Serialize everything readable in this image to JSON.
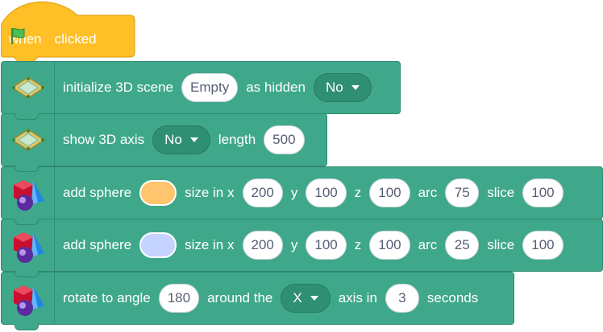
{
  "hat": {
    "when": "when",
    "clicked": "clicked"
  },
  "blocks": {
    "init": {
      "label": "initialize 3D scene",
      "scene_value": "Empty",
      "mid": "as hidden",
      "hidden_value": "No"
    },
    "axis": {
      "label": "show 3D axis",
      "axis_value": "No",
      "mid": "length",
      "length_value": "500"
    },
    "sphere1": {
      "label": "add sphere",
      "color": "#ffc46e",
      "size_label": "size in x",
      "x": "200",
      "y_label": "y",
      "y": "100",
      "z_label": "z",
      "z": "100",
      "arc_label": "arc",
      "arc": "75",
      "slice_label": "slice",
      "slice": "100"
    },
    "sphere2": {
      "label": "add sphere",
      "color": "#c4d3ff",
      "size_label": "size in x",
      "x": "200",
      "y_label": "y",
      "y": "100",
      "z_label": "z",
      "z": "100",
      "arc_label": "arc",
      "arc": "25",
      "slice_label": "slice",
      "slice": "100"
    },
    "rotate": {
      "label": "rotate to angle",
      "angle": "180",
      "mid": "around the",
      "axis_value": "X",
      "axis_in": "axis in",
      "seconds_value": "3",
      "seconds": "seconds"
    }
  },
  "icons": {
    "hat_flag": "green-flag-icon",
    "scene": "scene-plane-icon",
    "shapes": "3d-shapes-icon"
  },
  "colors": {
    "event_yellow": "#ffbf26",
    "block_teal": "#3fa88b",
    "dropdown_teal": "#2f8f73",
    "flag_green": "#4cbf56"
  }
}
